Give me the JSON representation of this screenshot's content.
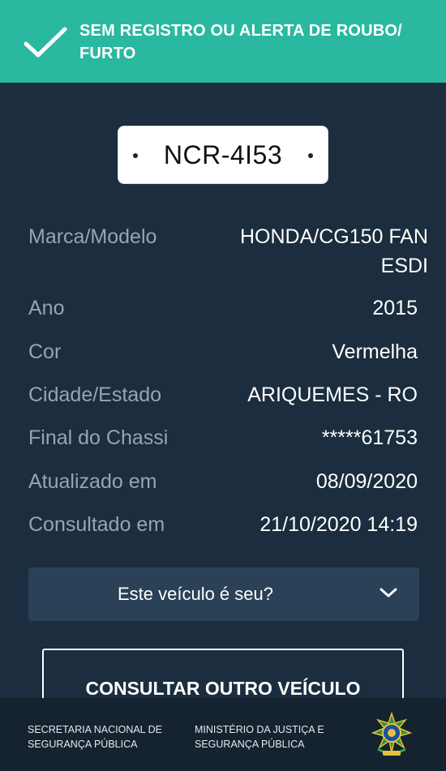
{
  "banner": {
    "line1": "SEM REGISTRO OU ALERTA DE ROUBO/",
    "line2": "FURTO",
    "icon": "check-icon",
    "color": "#2ab8a0"
  },
  "plate": {
    "number": "NCR-4I53"
  },
  "vehicle": {
    "rows": [
      {
        "label": "Marca/Modelo",
        "value_line1": "HONDA/CG150 FAN",
        "value_line2": "ESDI"
      },
      {
        "label": "Ano",
        "value": "2015"
      },
      {
        "label": "Cor",
        "value": "Vermelha"
      },
      {
        "label": "Cidade/Estado",
        "value": "ARIQUEMES - RO"
      },
      {
        "label": "Final do Chassi",
        "value": "*****61753"
      },
      {
        "label": "Atualizado em",
        "value": "08/09/2020"
      },
      {
        "label": "Consultado em",
        "value": "21/10/2020 14:19"
      }
    ]
  },
  "ownership": {
    "question": "Este veículo é seu?",
    "icon": "chevron-down-icon"
  },
  "actions": {
    "consult_other": "CONSULTAR OUTRO VEÍCULO"
  },
  "footer": {
    "org1_line1": "SECRETARIA NACIONAL DE",
    "org1_line2": "SEGURANÇA PÚBLICA",
    "org2_line1": "MINISTÉRIO DA JUSTIÇA E",
    "org2_line2": "SEGURANÇA PÚBLICA",
    "emblem": "brazil-coat-of-arms-icon"
  },
  "colors": {
    "background": "#1b2d3e",
    "banner": "#2ab8a0",
    "accordion": "#2a4157",
    "label": "#98a4b0"
  }
}
